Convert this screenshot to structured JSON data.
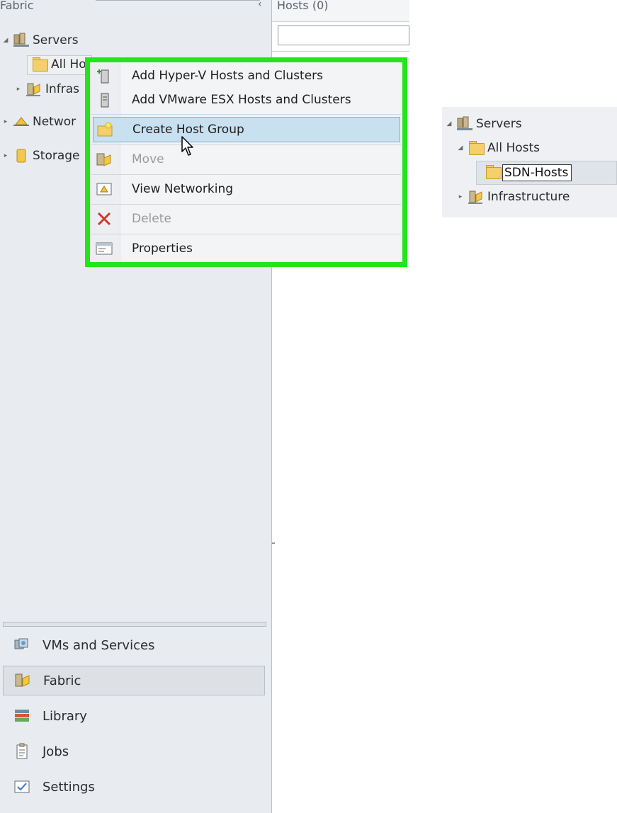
{
  "left_pane": {
    "title": "Fabric",
    "collapse_glyph": "‹",
    "tree": {
      "servers": "Servers",
      "all_hosts": "All Ho",
      "infrastructure": "Infras",
      "networking": "Networ",
      "storage": "Storage"
    },
    "nav": [
      {
        "label": "VMs and Services",
        "icon": "vms-services-icon"
      },
      {
        "label": "Fabric",
        "icon": "fabric-icon"
      },
      {
        "label": "Library",
        "icon": "library-icon"
      },
      {
        "label": "Jobs",
        "icon": "jobs-icon"
      },
      {
        "label": "Settings",
        "icon": "settings-icon"
      }
    ]
  },
  "hosts_pane": {
    "title": "Hosts (0)",
    "search_value": ""
  },
  "context_menu": {
    "items": [
      {
        "label": "Add Hyper-V Hosts and Clusters",
        "icon": "add-hyperv-host-icon",
        "enabled": true
      },
      {
        "label": "Add VMware ESX Hosts and Clusters",
        "icon": "add-esx-host-icon",
        "enabled": true
      },
      {
        "label": "Create Host Group",
        "icon": "create-host-group-icon",
        "enabled": true,
        "hovered": true
      },
      {
        "label": "Move",
        "icon": "move-icon",
        "enabled": false
      },
      {
        "label": "View Networking",
        "icon": "view-networking-icon",
        "enabled": true
      },
      {
        "label": "Delete",
        "icon": "delete-icon",
        "enabled": false
      },
      {
        "label": "Properties",
        "icon": "properties-icon",
        "enabled": true
      }
    ],
    "highlight_color": "#22e51a"
  },
  "inset_tree": {
    "servers": "Servers",
    "all_hosts": "All Hosts",
    "new_group_name": "SDN-Hosts",
    "infrastructure": "Infrastructure"
  }
}
